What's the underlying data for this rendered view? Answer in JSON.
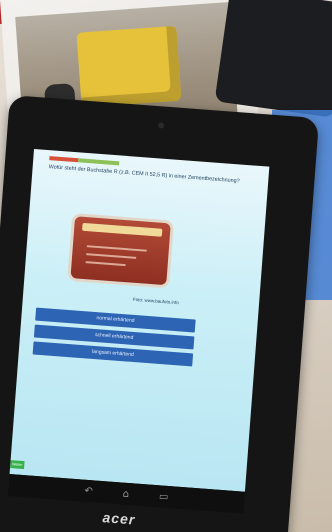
{
  "screen": {
    "progress_fraction": 0.42,
    "question": "Wofür steht der Buchstabe R (z.B. CEM II 52,5 R) in einer Zementbezeichnung?",
    "image_credit": "Foto: www.baufoto.info",
    "options": [
      {
        "label": "normal erhärtend"
      },
      {
        "label": "schnell erhärtend"
      },
      {
        "label": "langsam erhärtend"
      }
    ],
    "next_button": "Weiter"
  },
  "device": {
    "brand": "acer"
  },
  "colors": {
    "option_button": "#2d64b4",
    "next_button": "#38b24a",
    "progress_done": "#d84f3a",
    "progress_rest": "#8dc057"
  },
  "nav_icons": [
    "back-icon",
    "home-icon",
    "recents-icon"
  ]
}
